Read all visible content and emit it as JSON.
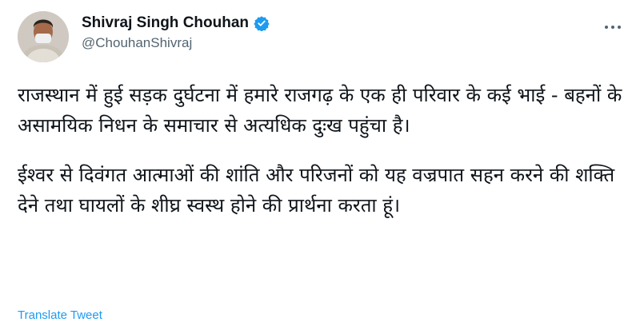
{
  "author": {
    "display_name": "Shivraj Singh Chouhan",
    "handle": "@ChouhanShivraj",
    "verified_icon": "verified-badge-icon",
    "verified_color": "#1d9bf0"
  },
  "tweet": {
    "paragraph_1": "राजस्थान में हुई सड़क दुर्घटना में हमारे राजगढ़ के एक ही परिवार के कई भाई - बहनों के असामयिक निधन के समाचार से अत्यधिक दुःख पहुंचा है।",
    "paragraph_2": "ईश्वर से दिवंगत आत्माओं की शांति और परिजनों को यह वज्रपात सहन करने की शक्ति देने तथा घायलों के शीघ्र स्वस्थ होने की प्रार्थना करता हूं।"
  },
  "actions": {
    "translate_label": "Translate Tweet",
    "more_icon": "more-options-icon"
  },
  "colors": {
    "text": "#0f1419",
    "secondary": "#536471",
    "link": "#1d9bf0"
  }
}
